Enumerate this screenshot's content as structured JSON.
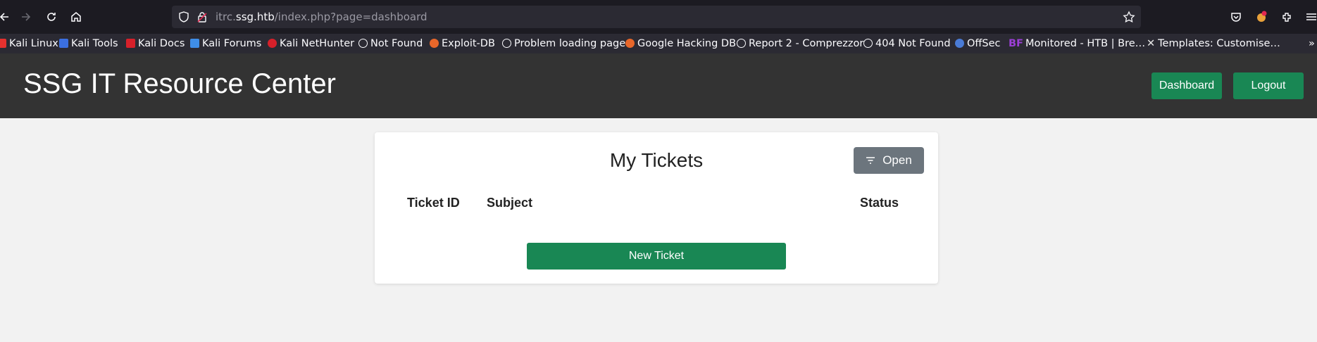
{
  "browser": {
    "url_host_prefix": "itrc.",
    "url_host": "ssg.htb",
    "url_path": "/index.php?page=dashboard",
    "bookmarks": [
      {
        "label": "Kali Linux",
        "color": "#e5312e"
      },
      {
        "label": "Kali Tools",
        "color": "#3b6fe0"
      },
      {
        "label": "Kali Docs",
        "color": "#d6202a"
      },
      {
        "label": "Kali Forums",
        "color": "#3f8ee8"
      },
      {
        "label": "Kali NetHunter",
        "color": "#d6202a"
      },
      {
        "label": "Not Found",
        "color": "globe"
      },
      {
        "label": "Exploit-DB",
        "color": "#e8672a"
      },
      {
        "label": "Problem loading page",
        "color": "globe"
      },
      {
        "label": "Google Hacking DB",
        "color": "#e8672a"
      },
      {
        "label": "Report 2 - Comprezzor",
        "color": "globe"
      },
      {
        "label": "404 Not Found",
        "color": "globe"
      },
      {
        "label": "OffSec",
        "color": "#4a7bd6"
      },
      {
        "label": "Monitored - HTB | Bre…",
        "color": "#9b3fd6",
        "prefix": "BF"
      },
      {
        "label": "Templates: Customise…",
        "color": "#e8e8e8"
      }
    ]
  },
  "header": {
    "title": "SSG IT Resource Center",
    "dashboard_label": "Dashboard",
    "logout_label": "Logout"
  },
  "card": {
    "title": "My Tickets",
    "filter_label": "Open",
    "columns": [
      "Ticket ID",
      "Subject",
      "Status"
    ],
    "new_ticket_label": "New Ticket"
  },
  "colors": {
    "header_bg": "#333333",
    "accent_green": "#198754",
    "filter_gray": "#6c757d"
  }
}
